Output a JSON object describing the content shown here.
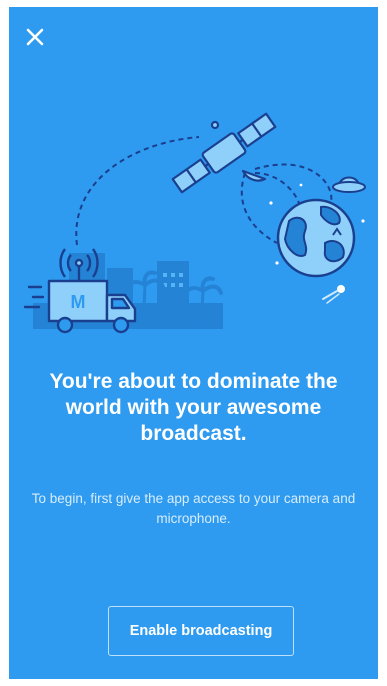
{
  "header": {
    "close_icon": "close-icon"
  },
  "colors": {
    "background": "#2e9bf0",
    "illustration_dark": "#1b3f8f",
    "illustration_light": "#8fd0fb",
    "text": "#ffffff"
  },
  "content": {
    "headline": "You're about to dominate the world with your awesome broadcast.",
    "subtext": "To begin, first give the app access to your camera and microphone."
  },
  "actions": {
    "enable_label": "Enable broadcasting"
  },
  "illustration": {
    "truck_logo": "M"
  }
}
